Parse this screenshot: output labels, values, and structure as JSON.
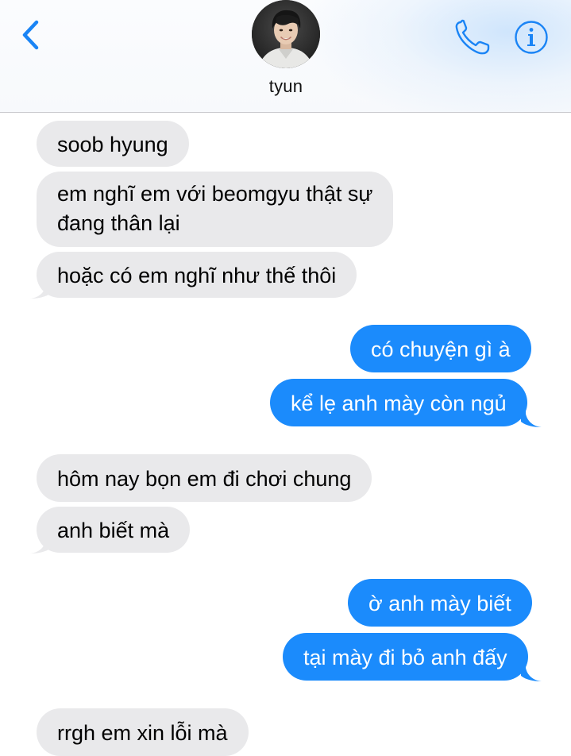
{
  "header": {
    "contact_name": "tyun",
    "back_icon": "chevron-left-icon",
    "call_icon": "phone-icon",
    "info_icon": "info-icon",
    "accent_color": "#1a84f5"
  },
  "messages": [
    {
      "direction": "incoming",
      "text": "soob hyung"
    },
    {
      "direction": "incoming",
      "text": "em nghĩ em với beomgyu thật sự",
      "text2": "đang thân lại"
    },
    {
      "direction": "incoming",
      "text": "hoặc có em nghĩ như thế thôi"
    },
    {
      "direction": "outgoing",
      "text": "có chuyện gì à"
    },
    {
      "direction": "outgoing",
      "text": "kể lẹ anh mày còn ngủ"
    },
    {
      "direction": "incoming",
      "text": "hôm nay bọn em đi chơi chung"
    },
    {
      "direction": "incoming",
      "text": "anh biết mà"
    },
    {
      "direction": "outgoing",
      "text": "ờ anh mày biết"
    },
    {
      "direction": "outgoing",
      "text": "tại mày đi bỏ anh đấy"
    },
    {
      "direction": "incoming",
      "text": "rrgh em xin lỗi mà"
    }
  ],
  "colors": {
    "incoming_bubble": "#e9e9eb",
    "outgoing_bubble": "#1b8bfc"
  }
}
